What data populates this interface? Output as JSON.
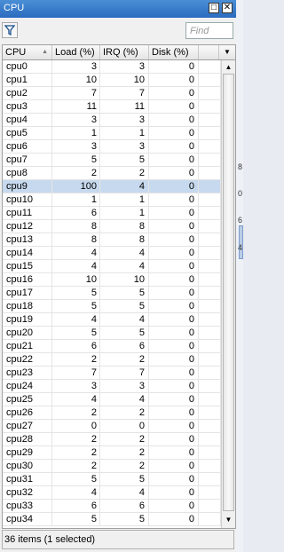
{
  "window": {
    "title": "CPU"
  },
  "toolbar": {
    "find_placeholder": "Find"
  },
  "table": {
    "columns": [
      "CPU",
      "Load (%)",
      "IRQ (%)",
      "Disk (%)"
    ],
    "sort_column": "CPU",
    "sort_direction": "ascending",
    "selected_index": 9,
    "rows": [
      {
        "cpu": "cpu0",
        "load": "3",
        "irq": "3",
        "disk": "0"
      },
      {
        "cpu": "cpu1",
        "load": "10",
        "irq": "10",
        "disk": "0"
      },
      {
        "cpu": "cpu2",
        "load": "7",
        "irq": "7",
        "disk": "0"
      },
      {
        "cpu": "cpu3",
        "load": "11",
        "irq": "11",
        "disk": "0"
      },
      {
        "cpu": "cpu4",
        "load": "3",
        "irq": "3",
        "disk": "0"
      },
      {
        "cpu": "cpu5",
        "load": "1",
        "irq": "1",
        "disk": "0"
      },
      {
        "cpu": "cpu6",
        "load": "3",
        "irq": "3",
        "disk": "0"
      },
      {
        "cpu": "cpu7",
        "load": "5",
        "irq": "5",
        "disk": "0"
      },
      {
        "cpu": "cpu8",
        "load": "2",
        "irq": "2",
        "disk": "0"
      },
      {
        "cpu": "cpu9",
        "load": "100",
        "irq": "4",
        "disk": "0"
      },
      {
        "cpu": "cpu10",
        "load": "1",
        "irq": "1",
        "disk": "0"
      },
      {
        "cpu": "cpu11",
        "load": "6",
        "irq": "1",
        "disk": "0"
      },
      {
        "cpu": "cpu12",
        "load": "8",
        "irq": "8",
        "disk": "0"
      },
      {
        "cpu": "cpu13",
        "load": "8",
        "irq": "8",
        "disk": "0"
      },
      {
        "cpu": "cpu14",
        "load": "4",
        "irq": "4",
        "disk": "0"
      },
      {
        "cpu": "cpu15",
        "load": "4",
        "irq": "4",
        "disk": "0"
      },
      {
        "cpu": "cpu16",
        "load": "10",
        "irq": "10",
        "disk": "0"
      },
      {
        "cpu": "cpu17",
        "load": "5",
        "irq": "5",
        "disk": "0"
      },
      {
        "cpu": "cpu18",
        "load": "5",
        "irq": "5",
        "disk": "0"
      },
      {
        "cpu": "cpu19",
        "load": "4",
        "irq": "4",
        "disk": "0"
      },
      {
        "cpu": "cpu20",
        "load": "5",
        "irq": "5",
        "disk": "0"
      },
      {
        "cpu": "cpu21",
        "load": "6",
        "irq": "6",
        "disk": "0"
      },
      {
        "cpu": "cpu22",
        "load": "2",
        "irq": "2",
        "disk": "0"
      },
      {
        "cpu": "cpu23",
        "load": "7",
        "irq": "7",
        "disk": "0"
      },
      {
        "cpu": "cpu24",
        "load": "3",
        "irq": "3",
        "disk": "0"
      },
      {
        "cpu": "cpu25",
        "load": "4",
        "irq": "4",
        "disk": "0"
      },
      {
        "cpu": "cpu26",
        "load": "2",
        "irq": "2",
        "disk": "0"
      },
      {
        "cpu": "cpu27",
        "load": "0",
        "irq": "0",
        "disk": "0"
      },
      {
        "cpu": "cpu28",
        "load": "2",
        "irq": "2",
        "disk": "0"
      },
      {
        "cpu": "cpu29",
        "load": "2",
        "irq": "2",
        "disk": "0"
      },
      {
        "cpu": "cpu30",
        "load": "2",
        "irq": "2",
        "disk": "0"
      },
      {
        "cpu": "cpu31",
        "load": "5",
        "irq": "5",
        "disk": "0"
      },
      {
        "cpu": "cpu32",
        "load": "4",
        "irq": "4",
        "disk": "0"
      },
      {
        "cpu": "cpu33",
        "load": "6",
        "irq": "6",
        "disk": "0"
      },
      {
        "cpu": "cpu34",
        "load": "5",
        "irq": "5",
        "disk": "0"
      }
    ]
  },
  "status": {
    "text": "36 items (1 selected)"
  },
  "background_fragments": [
    "8",
    "0",
    "6",
    "4"
  ],
  "colors": {
    "titlebar": "#2b6bc0",
    "selection": "#c7d9ee"
  }
}
